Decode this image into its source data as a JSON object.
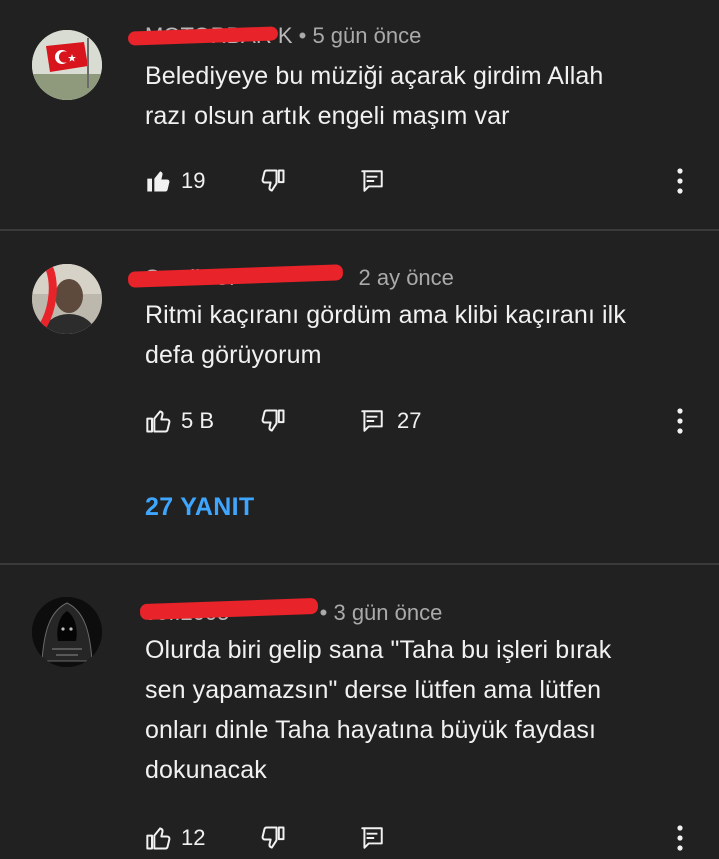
{
  "comments": [
    {
      "author": "MOTORBAR K",
      "time": "• 5 gün önce",
      "lines": [
        "Belediyeye bu müziği açarak girdim Allah",
        "razı olsun artık engeli maşım var"
      ],
      "likes": "19",
      "liked": true,
      "reply_count": "",
      "avatar_icon": "turkish-flag-avatar"
    },
    {
      "author": "Semih Ci",
      "time": "2 ay önce",
      "lines": [
        "Ritmi kaçıranı gördüm ama klibi kaçıranı ilk",
        "defa görüyorum"
      ],
      "likes": "5 B",
      "liked": false,
      "reply_count": "27",
      "replies_label": "27 YANIT",
      "avatar_icon": "person-avatar"
    },
    {
      "author": "ve..2005",
      "time": "• 3 gün önce",
      "lines": [
        "Olurda biri gelip sana \"Taha bu işleri bırak",
        "sen yapamazsın\" derse lütfen ama lütfen",
        "onları dinle Taha hayatına büyük faydası",
        "dokunacak"
      ],
      "likes": "12",
      "liked": false,
      "reply_count": "",
      "avatar_icon": "hooded-figure-avatar"
    }
  ],
  "colors": {
    "background": "#212121",
    "accent": "#3ea6ff",
    "redaction": "#e8232a"
  }
}
